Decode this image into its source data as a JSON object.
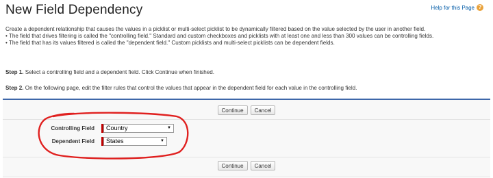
{
  "page": {
    "title": "New Field Dependency",
    "help_link": "Help for this Page",
    "help_icon": "question-icon"
  },
  "description": {
    "intro": "Create a dependent relationship that causes the values in a picklist or multi-select picklist to be dynamically filtered based on the value selected by the user in another field.",
    "bullet1": "• The field that drives filtering is called the \"controlling field.\" Standard and custom checkboxes and picklists with at least one and less than 300 values can be controlling fields.",
    "bullet2": "• The field that has its values filtered is called the \"dependent field.\" Custom picklists and multi-select picklists can be dependent fields."
  },
  "steps": {
    "step1_label": "Step 1.",
    "step1_text": " Select a controlling field and a dependent field. Click Continue when finished.",
    "step2_label": "Step 2.",
    "step2_text": " On the following page, edit the filter rules that control the values that appear in the dependent field for each value in the controlling field."
  },
  "buttons": {
    "continue": "Continue",
    "cancel": "Cancel"
  },
  "form": {
    "controlling_label": "Controlling Field",
    "controlling_value": "Country",
    "dependent_label": "Dependent Field",
    "dependent_value": "States",
    "caret": "▼"
  },
  "colors": {
    "accent": "#3e67a9",
    "required": "#c00000",
    "annotation": "#e0201f",
    "help_icon": "#e9a23b",
    "link": "#015ba7"
  }
}
